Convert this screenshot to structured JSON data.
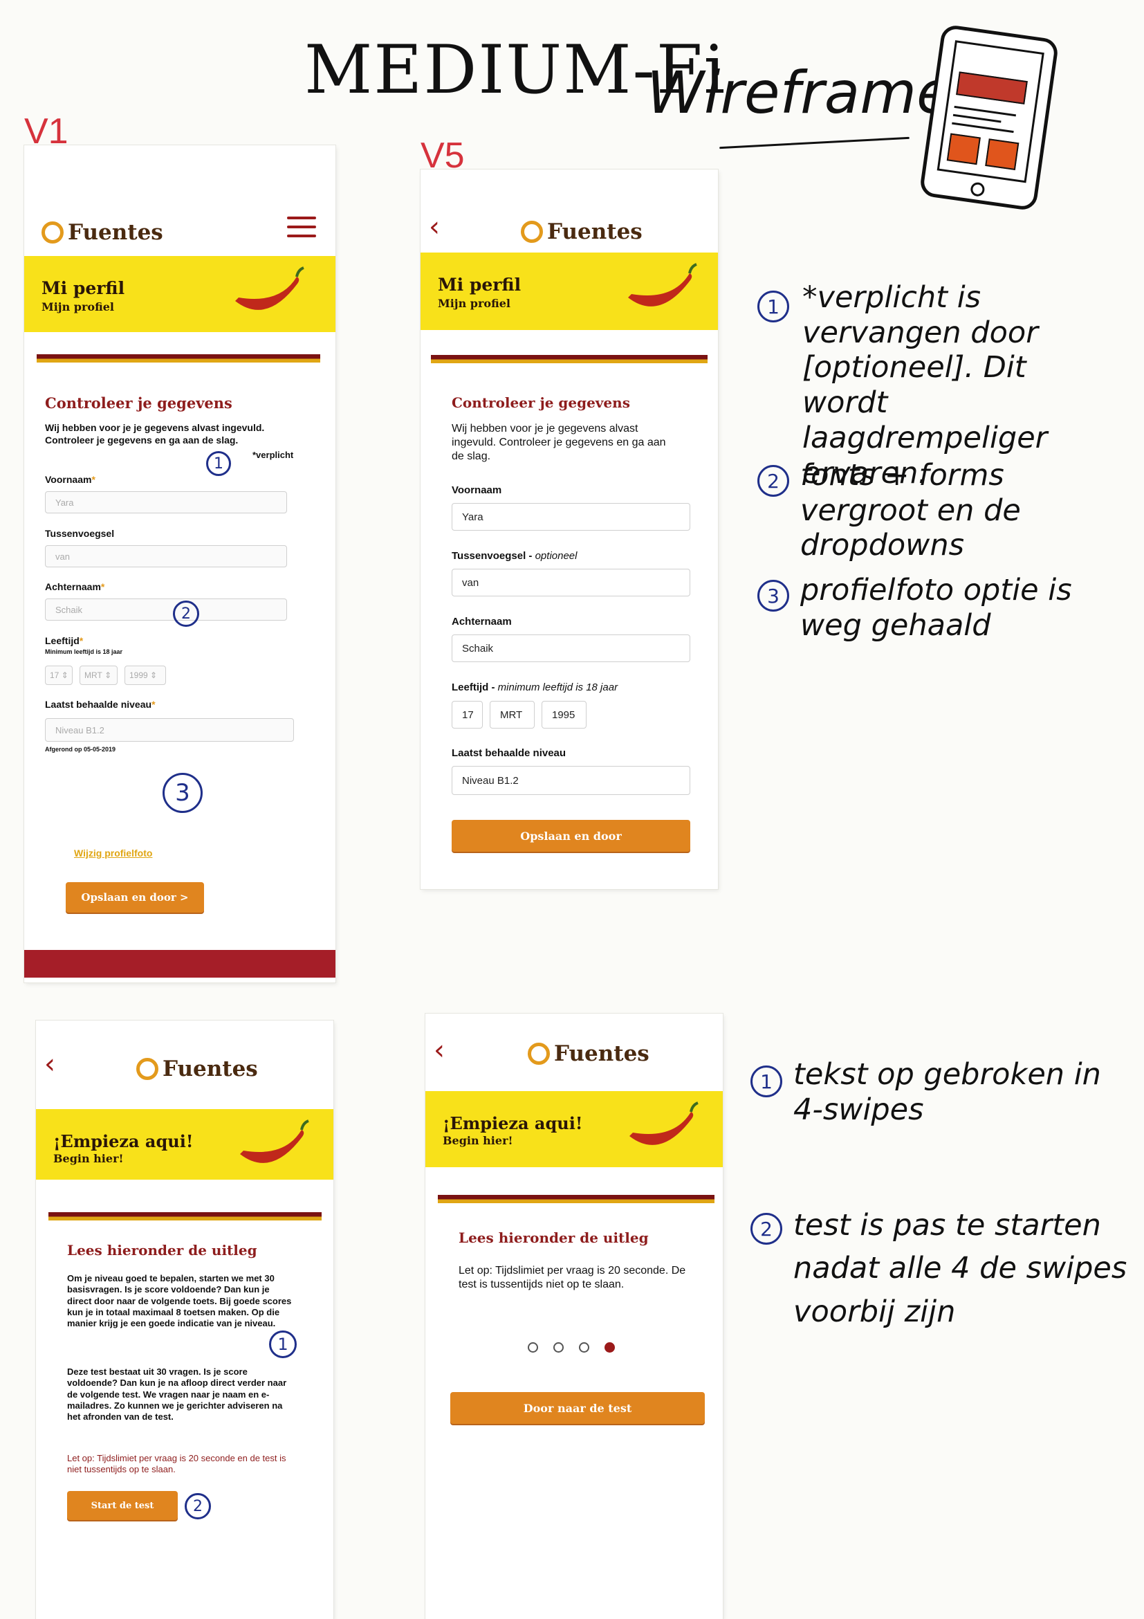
{
  "heading": {
    "part1": "MEDIUM-Fi",
    "part2": "Wireframes"
  },
  "versions": {
    "v1": "V1",
    "v5": "V5"
  },
  "brand": {
    "name": "Fuentes"
  },
  "colors": {
    "banner": "#f8e11a",
    "accent_red": "#8e1d1d",
    "button_orange": "#e0851f",
    "annotation_blue": "#1f2f8a",
    "version_red": "#d6323c"
  },
  "v1": {
    "banner_title": "Mi perfil",
    "banner_sub": "Mijn profiel",
    "section_title": "Controleer je gegevens",
    "intro": "Wij hebben voor je je gegevens alvast ingevuld. Controleer je gegevens en ga aan de slag.",
    "required_note": "*verplicht",
    "fields": {
      "voornaam_label": "Voornaam",
      "voornaam_value": "Yara",
      "tussenvoegsel_label": "Tussenvoegsel",
      "tussenvoegsel_value": "van",
      "achternaam_label": "Achternaam",
      "achternaam_value": "Schaik",
      "leeftijd_label": "Leeftijd",
      "leeftijd_hint": "Minimum leeftijd is 18 jaar",
      "day": "17",
      "month": "MRT",
      "year": "1999",
      "niveau_label": "Laatst behaalde niveau",
      "niveau_value": "Niveau B1.2",
      "niveau_note": "Afgerond op 05-05-2019"
    },
    "photo_link": "Wijzig profielfoto",
    "button": "Opslaan en door >"
  },
  "v5": {
    "banner_title": "Mi perfil",
    "banner_sub": "Mijn profiel",
    "section_title": "Controleer je gegevens",
    "intro": "Wij hebben voor je je gegevens alvast ingevuld. Controleer je gegevens en ga aan de slag.",
    "fields": {
      "voornaam_label": "Voornaam",
      "voornaam_value": "Yara",
      "tussenvoegsel_label": "Tussenvoegsel - ",
      "tussenvoegsel_optional": "optioneel",
      "tussenvoegsel_value": "van",
      "achternaam_label": "Achternaam",
      "achternaam_value": "Schaik",
      "leeftijd_label": "Leeftijd - ",
      "leeftijd_hint": "minimum leeftijd is 18 jaar",
      "day": "17",
      "month": "MRT",
      "year": "1995",
      "niveau_label": "Laatst behaalde niveau",
      "niveau_value": "Niveau B1.2"
    },
    "button": "Opslaan en door"
  },
  "empieza_v1": {
    "banner_title": "¡Empieza aqui!",
    "banner_sub": "Begin hier!",
    "section_title": "Lees hieronder de uitleg",
    "para1": "Om je niveau goed te bepalen, starten we met 30 basisvragen. Is je score voldoende? Dan kun je direct door naar de volgende toets. Bij goede scores kun je in totaal maximaal 8 toetsen maken. Op die manier krijg je een goede indicatie van je niveau.",
    "para2": "Deze test bestaat uit 30 vragen. Is je score voldoende? Dan kun je na afloop direct verder naar de volgende test. We vragen naar je naam en e-mailadres. Zo kunnen we je gerichter adviseren na het afronden van de test.",
    "warning": "Let op: Tijdslimiet per vraag is 20 seconde en de test is niet tussentijds op te slaan.",
    "button": "Start de test"
  },
  "empieza_v5": {
    "banner_title": "¡Empieza aqui!",
    "banner_sub": "Begin hier!",
    "section_title": "Lees hieronder de uitleg",
    "para": "Let op: Tijdslimiet per vraag is 20 seconde. De test is tussentijds niet op te slaan.",
    "swipe_pages": 4,
    "active_swipe": 4,
    "button": "Door naar de test"
  },
  "annotations": {
    "top": [
      "*verplicht is vervangen door [optioneel]. Dit wordt laagdrempeliger ervaren.",
      "fonts + forms vergroot en de dropdowns",
      "profielfoto optie is weg gehaald"
    ],
    "bottom": [
      "tekst op gebroken in 4-swipes",
      "test is pas te starten nadat alle 4 de swipes voorbij zijn"
    ],
    "numbers": [
      "1",
      "2",
      "3"
    ]
  }
}
